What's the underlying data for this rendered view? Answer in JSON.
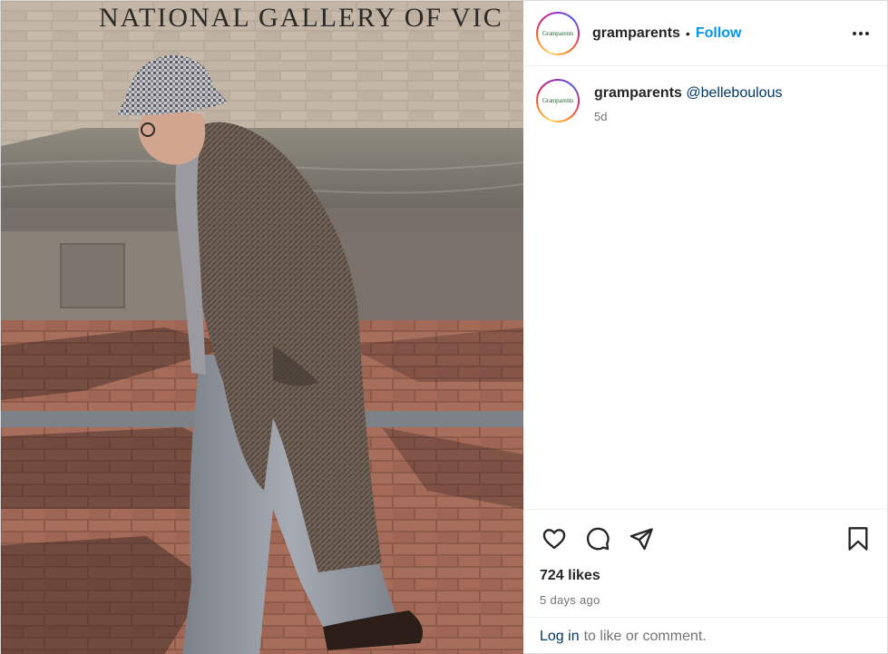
{
  "post": {
    "photo": {
      "alt": "",
      "building_sign": "NATIONAL GALLERY OF VIC"
    },
    "header": {
      "avatar_text": "Gramparents",
      "username": "gramparents",
      "separator": "•",
      "follow_label": "Follow"
    },
    "caption": {
      "avatar_text": "Gramparents",
      "username": "gramparents",
      "mention": "@belleboulous",
      "time": "5d"
    },
    "actions": {
      "like_icon": "heart-icon",
      "comment_icon": "comment-icon",
      "share_icon": "share-icon",
      "save_icon": "bookmark-icon"
    },
    "likes": "724 likes",
    "date": "5 days ago",
    "login": {
      "link": "Log in",
      "rest": "to like or comment."
    },
    "colors": {
      "accent": "#0095f6",
      "mention": "#00376b",
      "muted": "#737373"
    }
  }
}
